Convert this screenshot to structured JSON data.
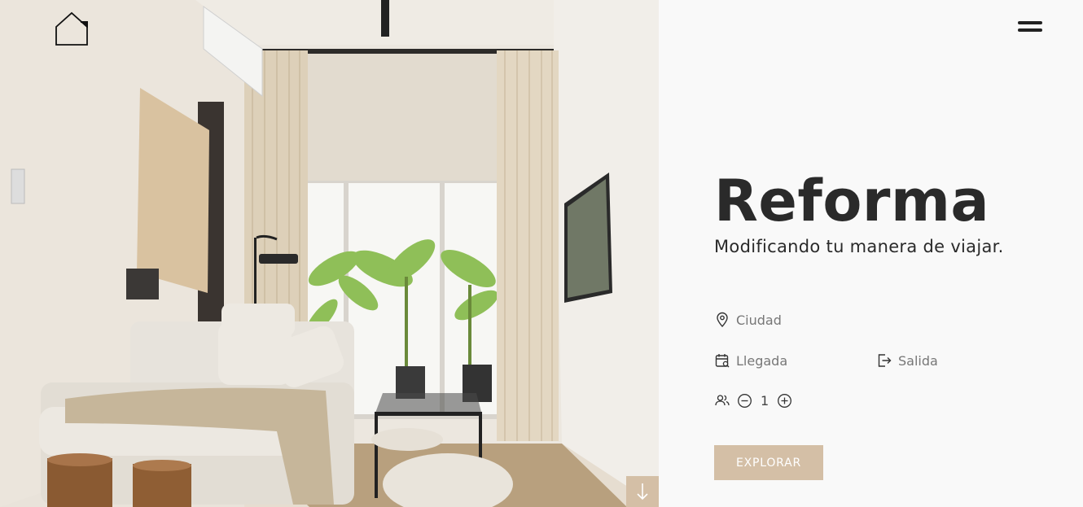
{
  "brand": {
    "logo": "house-outline-logo"
  },
  "hero": {
    "image": "living-room-photo",
    "scroll_icon": "arrow-down-icon"
  },
  "header": {
    "menu_icon": "hamburger-menu-icon"
  },
  "main": {
    "title": "Reforma",
    "subtitle": "Modificando tu manera de viajar."
  },
  "search": {
    "city": {
      "label": "Ciudad",
      "icon": "map-pin-icon"
    },
    "arrival": {
      "label": "Llegada",
      "icon": "calendar-search-icon"
    },
    "departure": {
      "label": "Salida",
      "icon": "sign-out-icon"
    },
    "guests": {
      "icon": "users-icon",
      "count": "1",
      "decrement_icon": "minus-circle-icon",
      "increment_icon": "plus-circle-icon"
    },
    "submit_label": "EXPLORAR"
  },
  "colors": {
    "accent": "#d4bfa6",
    "text": "#2a2a2a",
    "muted": "#777777",
    "panel_bg": "#f9f9f9"
  }
}
